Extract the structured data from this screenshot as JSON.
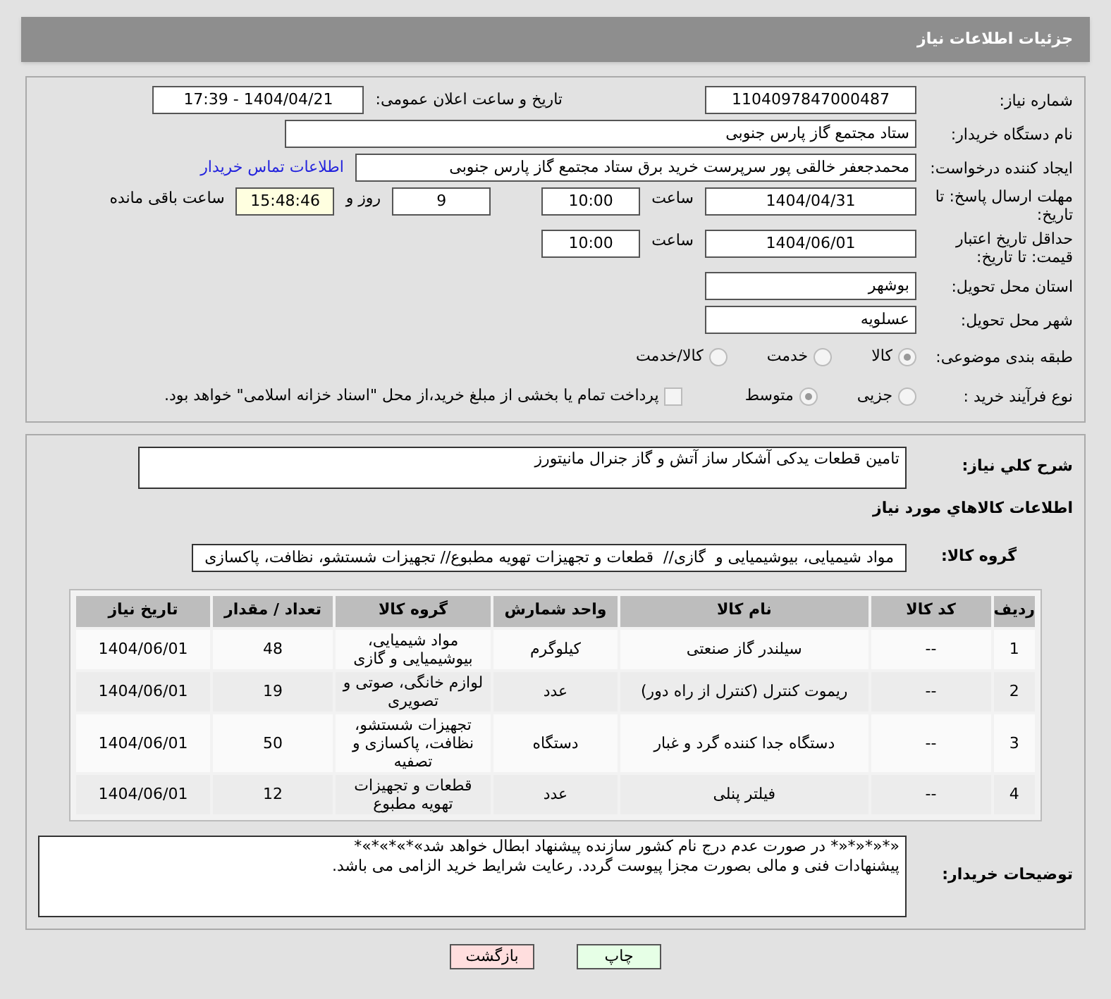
{
  "header": {
    "title": "جزئیات اطلاعات نیاز"
  },
  "need_number": {
    "label": "شماره نیاز:",
    "value": "1104097847000487"
  },
  "announce": {
    "label": "تاریخ و ساعت اعلان عمومی:",
    "value": "1404/04/21 - 17:39"
  },
  "buyer_org": {
    "label": "نام دستگاه خریدار:",
    "value": "ستاد مجتمع گاز پارس جنوبی"
  },
  "creator": {
    "label": "ایجاد کننده درخواست:",
    "value": "محمدجعفر خالقی پور سرپرست خرید برق ستاد مجتمع گاز پارس جنوبی",
    "link": "اطلاعات تماس خریدار"
  },
  "deadline": {
    "label": "مهلت ارسال پاسخ: تا تاریخ:",
    "date": "1404/04/31",
    "time_label": "ساعت",
    "time": "10:00",
    "days": "9",
    "days_label": "روز و",
    "remaining": "15:48:46",
    "remaining_label": "ساعت باقی مانده"
  },
  "validity": {
    "label": "حداقل تاریخ اعتبار قیمت: تا تاریخ:",
    "date": "1404/06/01",
    "time_label": "ساعت",
    "time": "10:00"
  },
  "province": {
    "label": "استان محل تحویل:",
    "value": "بوشهر"
  },
  "city": {
    "label": "شهر محل تحویل:",
    "value": "عسلویه"
  },
  "category": {
    "label": "طبقه بندی موضوعی:",
    "options": [
      {
        "label": "کالا",
        "selected": true
      },
      {
        "label": "خدمت",
        "selected": false
      },
      {
        "label": "کالا/خدمت",
        "selected": false
      }
    ]
  },
  "process": {
    "label": "نوع فرآیند خرید :",
    "options": [
      {
        "label": "جزیی",
        "selected": false
      },
      {
        "label": "متوسط",
        "selected": true
      }
    ],
    "treasury": {
      "label": "پرداخت تمام یا بخشی از مبلغ خرید،از محل \"اسناد خزانه اسلامی\" خواهد بود.",
      "checked": false
    }
  },
  "description": {
    "label": "شرح کلي نياز:",
    "value": "تامین قطعات یدکی آشکار ساز آتش و گاز جنرال مانیتورز"
  },
  "goods_heading": "اطلاعات کالاهاي مورد نياز",
  "goods_group": {
    "label": "گروه کالا:",
    "value": "مواد شیمیایی، بیوشیمیایی و  گازی//  قطعات و تجهیزات تهویه مطبوع// تجهیزات شستشو، نظافت، پاکسازی"
  },
  "table": {
    "columns": [
      "ردیف",
      "کد کالا",
      "نام کالا",
      "واحد شمارش",
      "گروه کالا",
      "تعداد / مقدار",
      "تاریخ نیاز"
    ],
    "rows": [
      [
        "1",
        "--",
        "سیلندر گاز صنعتی",
        "کیلوگرم",
        "مواد شیمیایی، بیوشیمیایی و گازی",
        "48",
        "1404/06/01"
      ],
      [
        "2",
        "--",
        "ریموت کنترل (کنترل از راه دور)",
        "عدد",
        "لوازم خانگی، صوتی و تصویری",
        "19",
        "1404/06/01"
      ],
      [
        "3",
        "--",
        "دستگاه جدا کننده گرد و غبار",
        "دستگاه",
        "تجهیزات شستشو، نظافت، پاکسازی و تصفیه",
        "50",
        "1404/06/01"
      ],
      [
        "4",
        "--",
        "فیلتر پنلی",
        "عدد",
        "قطعات و تجهیزات تهویه مطبوع",
        "12",
        "1404/06/01"
      ]
    ]
  },
  "notes": {
    "label": "توضیحات خریدار:",
    "lines": [
      "«*«*«*«* در صورت عدم درج نام کشور سازنده پیشنهاد ابطال خواهد شد»*»*»*»*",
      "پیشنهادات فنی و مالی بصورت مجزا پیوست گردد. رعایت شرایط خرید الزامی می باشد."
    ]
  },
  "buttons": [
    {
      "label": "چاپ",
      "kind": "print"
    },
    {
      "label": "بازگشت",
      "kind": "back"
    }
  ]
}
